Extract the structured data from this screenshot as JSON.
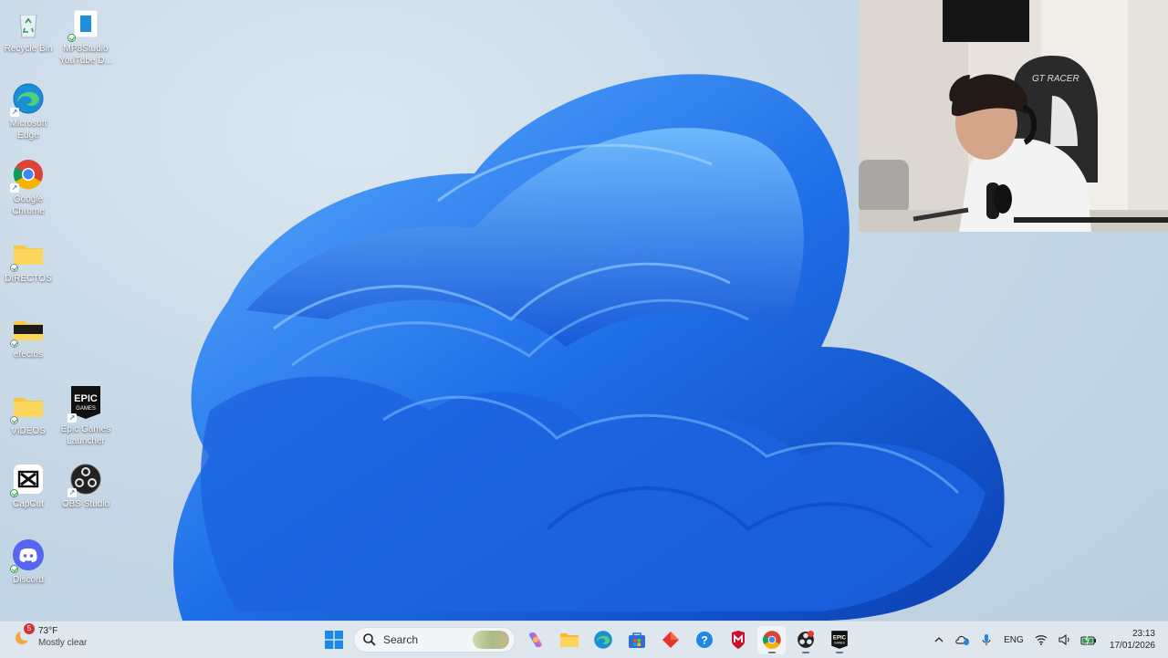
{
  "desktop": {
    "icons": [
      {
        "label": "Recycle Bin",
        "icon": "recycle-bin-icon"
      },
      {
        "label": "MP8Studio YouTube D...",
        "icon": "mp8studio-icon"
      },
      {
        "label": "Microsoft Edge",
        "icon": "edge-icon"
      },
      {
        "label": "Google Chrome",
        "icon": "chrome-icon"
      },
      {
        "label": "DIRECTOS",
        "icon": "folder-icon"
      },
      {
        "label": "efectos",
        "icon": "folder-icon"
      },
      {
        "label": "VIDEOS",
        "icon": "folder-icon"
      },
      {
        "label": "Epic Games Launcher",
        "icon": "epic-games-icon"
      },
      {
        "label": "CapCut",
        "icon": "capcut-icon"
      },
      {
        "label": "OBS Studio",
        "icon": "obs-icon"
      },
      {
        "label": "Discord",
        "icon": "discord-icon"
      }
    ]
  },
  "webcam": {
    "chair_brand": "GT RACER"
  },
  "taskbar": {
    "weather": {
      "temp": "73°F",
      "condition": "Mostly clear",
      "badge": "5"
    },
    "search": {
      "placeholder": "Search"
    },
    "apps": [
      "start-icon",
      "search",
      "copilot-icon",
      "file-explorer-icon",
      "edge-icon",
      "store-icon",
      "app-red-diamond-icon",
      "help-icon",
      "mcafee-icon",
      "chrome-icon",
      "obs-icon",
      "epic-games-icon"
    ],
    "epic_label": "EPIC GAMES",
    "tray": {
      "language": "ENG",
      "time": "23:13",
      "date": "17/01/2026"
    }
  },
  "colors": {
    "wallpaper_bloom": "#1f6fe8",
    "taskbar_bg": "#dfe7ee",
    "discord": "#5865f2",
    "folder": "#f5c842"
  }
}
